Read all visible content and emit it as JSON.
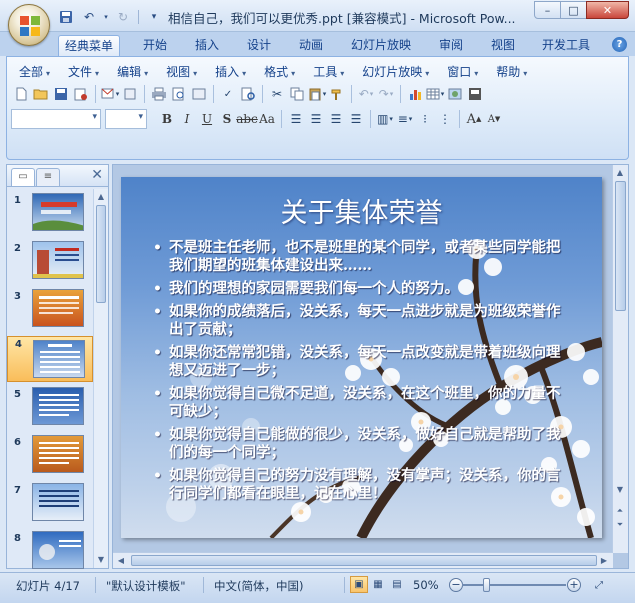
{
  "window": {
    "title": "相信自己，我们可以更优秀.ppt [兼容模式] - Microsoft Pow...",
    "controls": {
      "minimize": "–",
      "maximize": "□",
      "close": "✕"
    }
  },
  "ribbon": {
    "tabs": [
      "经典菜单",
      "开始",
      "插入",
      "设计",
      "动画",
      "幻灯片放映",
      "审阅",
      "视图",
      "开发工具"
    ],
    "active_tab": "经典菜单",
    "help": "?"
  },
  "classic_menu": {
    "items": [
      "全部",
      "文件",
      "编辑",
      "视图",
      "插入",
      "格式",
      "工具",
      "幻灯片放映",
      "窗口",
      "帮助"
    ]
  },
  "pane": {
    "slide_numbers": [
      "1",
      "2",
      "3",
      "4",
      "5",
      "6",
      "7",
      "8"
    ],
    "selected_slide": "4"
  },
  "slide": {
    "title": "关于集体荣誉",
    "bullets": [
      "不是班主任老师，也不是班里的某个同学，或者某些同学能把我们期望的班集体建设出来……",
      " 我们的理想的家园需要我们每一个人的努力。",
      " 如果你的成绩落后，没关系，每天一点进步就是为班级荣誉作出了贡献；",
      "如果你还常常犯错，没关系，每天一点改变就是带着班级向理想又迈进了一步；",
      "如果你觉得自己微不足道，没关系，在这个班里，你的力量不可缺少；",
      "如果你觉得自己能做的很少，没关系，做好自己就是帮助了我们的每一个同学；",
      "如果你觉得自己的努力没有理解，没有掌声；没关系，你的言行同学们都看在眼里，记在心里！"
    ]
  },
  "status": {
    "slide_info": "幻灯片 4/17",
    "template": "\"默认设计模板\"",
    "language": "中文(简体，中国)",
    "zoom": "50%",
    "zoom_fraction": 0.23
  },
  "colors": {
    "ribbon_bg": "#bcd2ee",
    "selection": "#f9bd5a",
    "slide_text": "#ffffff"
  }
}
